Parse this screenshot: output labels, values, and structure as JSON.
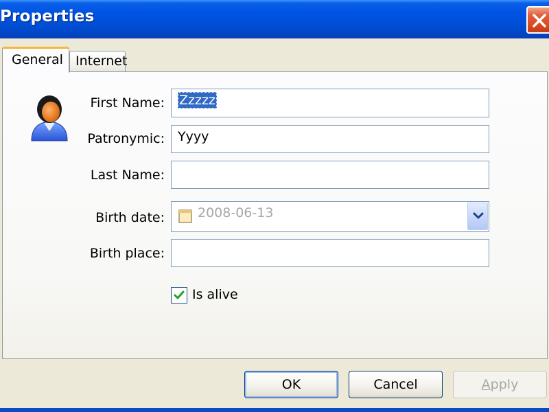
{
  "window": {
    "title": "Properties"
  },
  "tabs": [
    {
      "label": "General",
      "active": true
    },
    {
      "label": "Internet",
      "active": false
    }
  ],
  "form": {
    "first_name": {
      "label": "First Name:",
      "value": "Zzzzz"
    },
    "patronymic": {
      "label": "Patronymic:",
      "value": "Yyyy"
    },
    "last_name": {
      "label": "Last Name:",
      "value": ""
    },
    "birth_date": {
      "label": "Birth date:",
      "value": "2008-06-13"
    },
    "birth_place": {
      "label": "Birth place:",
      "value": ""
    },
    "is_alive": {
      "label": "Is alive",
      "checked": true
    }
  },
  "buttons": {
    "ok": "OK",
    "cancel": "Cancel",
    "apply_mnemonic": "A",
    "apply_rest": "pply"
  },
  "icons": {
    "close": "close-icon",
    "avatar": "user-icon",
    "calendar": "calendar-icon",
    "dropdown": "chevron-down-icon",
    "check": "check-icon"
  },
  "colors": {
    "titlebar": "#0054E3",
    "selection": "#316AC5",
    "close_button": "#D94A22",
    "active_tab_accent": "#F6B53F"
  }
}
